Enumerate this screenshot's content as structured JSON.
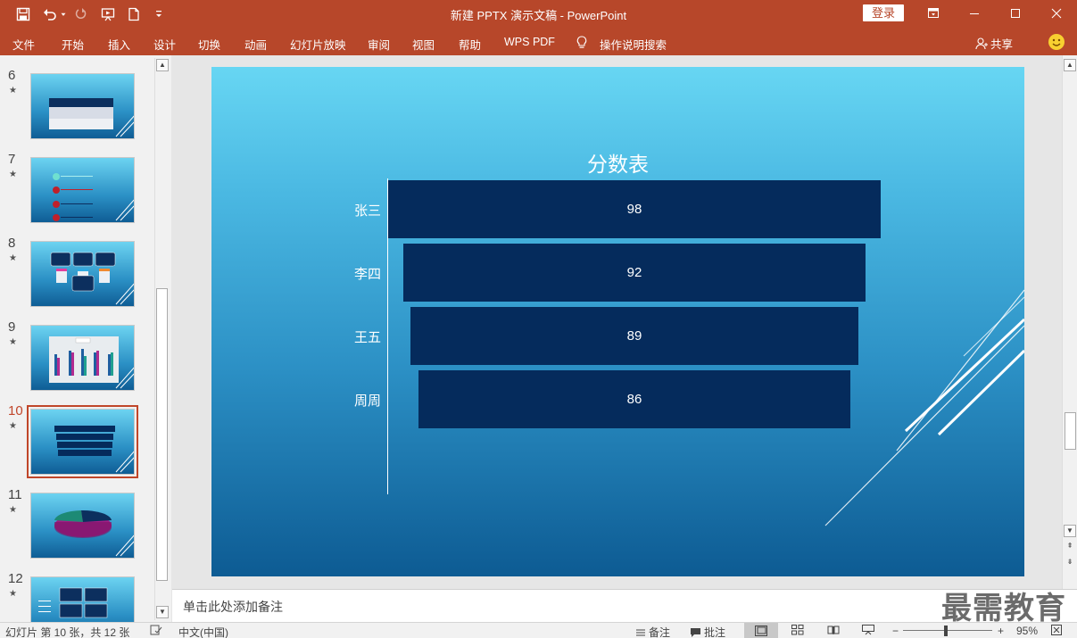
{
  "titlebar": {
    "title": "新建 PPTX 演示文稿  -  PowerPoint",
    "login_label": "登录",
    "quick_access": [
      "save-icon",
      "undo-icon",
      "redo-icon",
      "start-presentation-icon",
      "new-file-icon",
      "customize-icon"
    ],
    "window_buttons": [
      "ribbon-display-icon",
      "minimize-icon",
      "maximize-icon",
      "close-icon"
    ]
  },
  "ribbon": {
    "tabs": [
      "文件",
      "开始",
      "插入",
      "设计",
      "切换",
      "动画",
      "幻灯片放映",
      "审阅",
      "视图",
      "帮助",
      "WPS PDF",
      "操作说明搜索"
    ],
    "share_label": "共享"
  },
  "thumbnails": [
    {
      "num": "6",
      "star": "★"
    },
    {
      "num": "7",
      "star": "★"
    },
    {
      "num": "8",
      "star": "★"
    },
    {
      "num": "9",
      "star": "★"
    },
    {
      "num": "10",
      "star": "★"
    },
    {
      "num": "11",
      "star": "★"
    },
    {
      "num": "12",
      "star": "★"
    }
  ],
  "selected_slide": "10",
  "chart_data": {
    "type": "bar",
    "title": "分数表",
    "categories": [
      "张三",
      "李四",
      "王五",
      "周周"
    ],
    "values": [
      98,
      92,
      89,
      86
    ],
    "style": "funnel",
    "bar_color": "#052b5c",
    "label_color": "#ffffff"
  },
  "notes": {
    "placeholder": "单击此处添加备注"
  },
  "watermark": "最需教育",
  "statusbar": {
    "slide_info": "幻灯片 第 10 张，共 12 张",
    "language": "中文(中国)",
    "notes_label": "备注",
    "comments_label": "批注",
    "zoom_minus": "−",
    "zoom_plus": "+",
    "zoom_level": "95%"
  },
  "colors": {
    "accent": "#b7472a",
    "slide_top": "#67d6f3",
    "slide_bottom": "#0d5b93"
  }
}
